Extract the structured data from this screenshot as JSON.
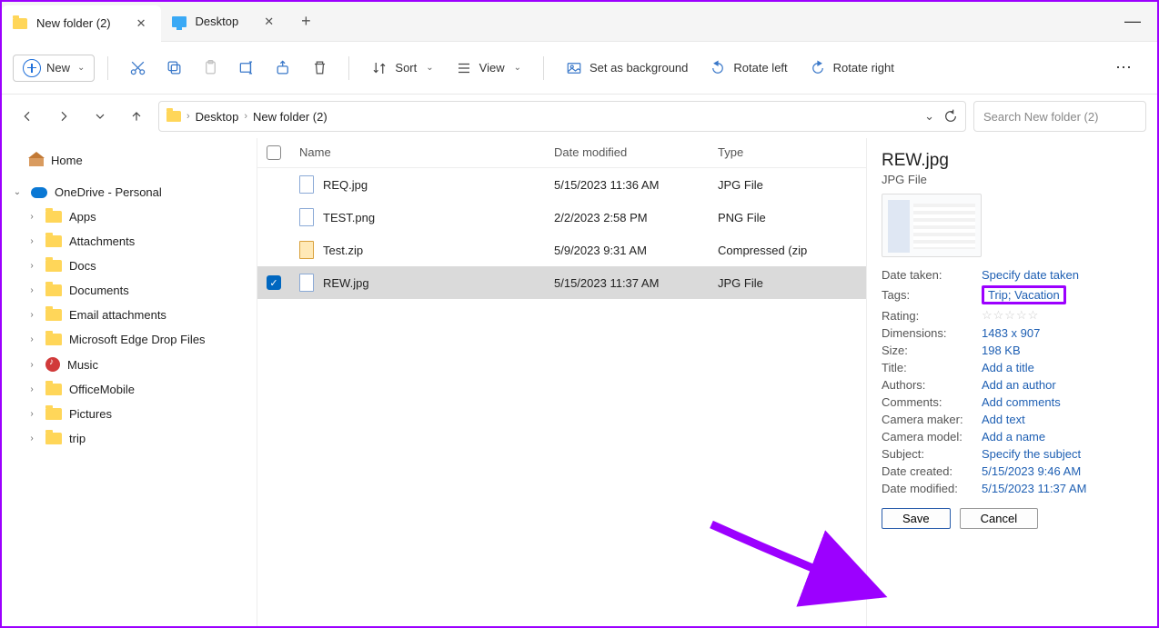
{
  "titlebar": {
    "tabs": [
      {
        "label": "New folder (2)",
        "active": true,
        "icon": "folder"
      },
      {
        "label": "Desktop",
        "active": false,
        "icon": "desktop"
      }
    ]
  },
  "toolbar": {
    "new_label": "New",
    "sort_label": "Sort",
    "view_label": "View",
    "set_bg_label": "Set as background",
    "rotate_left_label": "Rotate left",
    "rotate_right_label": "Rotate right"
  },
  "breadcrumb": {
    "items": [
      "Desktop",
      "New folder (2)"
    ]
  },
  "search": {
    "placeholder": "Search New folder (2)"
  },
  "sidebar": {
    "home": "Home",
    "onedrive": "OneDrive - Personal",
    "items": [
      "Apps",
      "Attachments",
      "Docs",
      "Documents",
      "Email attachments",
      "Microsoft Edge Drop Files",
      "Music",
      "OfficeMobile",
      "Pictures",
      "trip"
    ]
  },
  "columns": {
    "name": "Name",
    "date": "Date modified",
    "type": "Type"
  },
  "files": [
    {
      "name": "REQ.jpg",
      "date": "5/15/2023 11:36 AM",
      "type": "JPG File",
      "icon": "img",
      "selected": false
    },
    {
      "name": "TEST.png",
      "date": "2/2/2023 2:58 PM",
      "type": "PNG File",
      "icon": "img",
      "selected": false
    },
    {
      "name": "Test.zip",
      "date": "5/9/2023 9:31 AM",
      "type": "Compressed (zip",
      "icon": "zip",
      "selected": false
    },
    {
      "name": "REW.jpg",
      "date": "5/15/2023 11:37 AM",
      "type": "JPG File",
      "icon": "img",
      "selected": true
    }
  ],
  "details": {
    "title": "REW.jpg",
    "subtitle": "JPG File",
    "meta": {
      "date_taken_label": "Date taken:",
      "date_taken_val": "Specify date taken",
      "tags_label": "Tags:",
      "tags_val": "Trip; Vacation",
      "rating_label": "Rating:",
      "dimensions_label": "Dimensions:",
      "dimensions_val": "1483 x 907",
      "size_label": "Size:",
      "size_val": "198 KB",
      "title_label": "Title:",
      "title_val": "Add a title",
      "authors_label": "Authors:",
      "authors_val": "Add an author",
      "comments_label": "Comments:",
      "comments_val": "Add comments",
      "camera_maker_label": "Camera maker:",
      "camera_maker_val": "Add text",
      "camera_model_label": "Camera model:",
      "camera_model_val": "Add a name",
      "subject_label": "Subject:",
      "subject_val": "Specify the subject",
      "date_created_label": "Date created:",
      "date_created_val": "5/15/2023 9:46 AM",
      "date_modified_label": "Date modified:",
      "date_modified_val": "5/15/2023 11:37 AM"
    },
    "save_label": "Save",
    "cancel_label": "Cancel"
  }
}
